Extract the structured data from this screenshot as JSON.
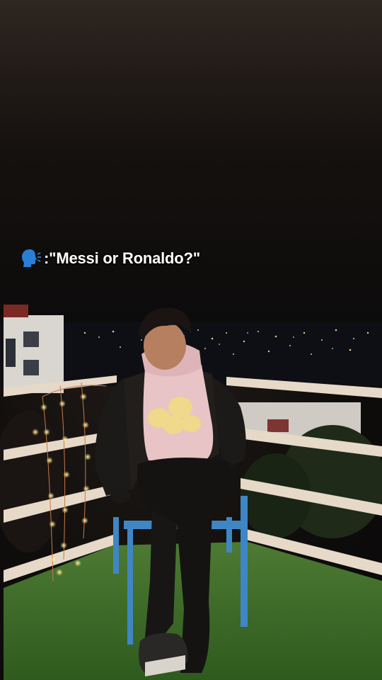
{
  "caption": {
    "icon": "speaking-head-icon",
    "text": ":\"Messi or Ronaldo?\""
  },
  "colors": {
    "sky": "#1a1512",
    "grass": "#3e6b2a",
    "chair": "#3f86c4",
    "hoodie": "#e8c4c6",
    "jacket": "#1c1a19",
    "railing": "#e8dccd",
    "fairy_lights": "#ffd36b"
  }
}
